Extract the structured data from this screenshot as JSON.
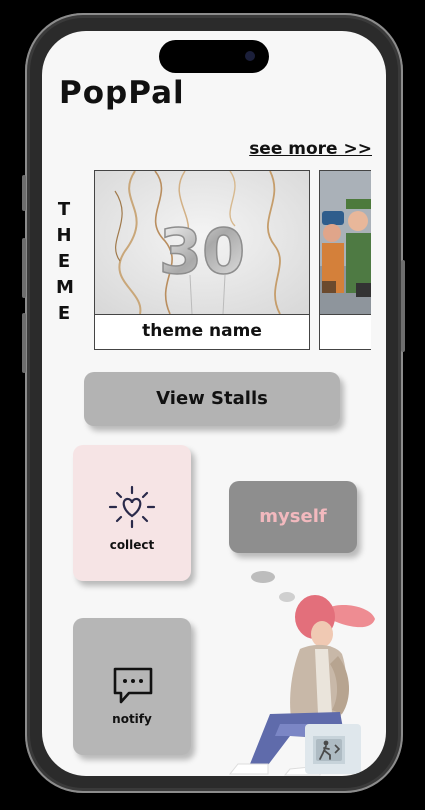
{
  "app": {
    "title": "PopPal"
  },
  "theme_section": {
    "see_more": "see more >>",
    "vertical_label": [
      "T",
      "H",
      "E",
      "M",
      "E"
    ],
    "cards": [
      {
        "name": "theme name",
        "image": "balloon-30-image"
      },
      {
        "name": "",
        "image": "characters-image"
      }
    ]
  },
  "actions": {
    "view_stalls": "View Stalls",
    "collect": "collect",
    "myself": "myself",
    "notify": "notify"
  },
  "colors": {
    "collect_tile": "#f6e4e5",
    "myself_tile": "#8e8e8e",
    "myself_text": "#f2b9be",
    "notify_tile": "#b6b6b6",
    "button": "#b3b3b3"
  },
  "icons": [
    "heart-sparkle-icon",
    "chat-bubble-icon",
    "exit-sign-icon"
  ]
}
